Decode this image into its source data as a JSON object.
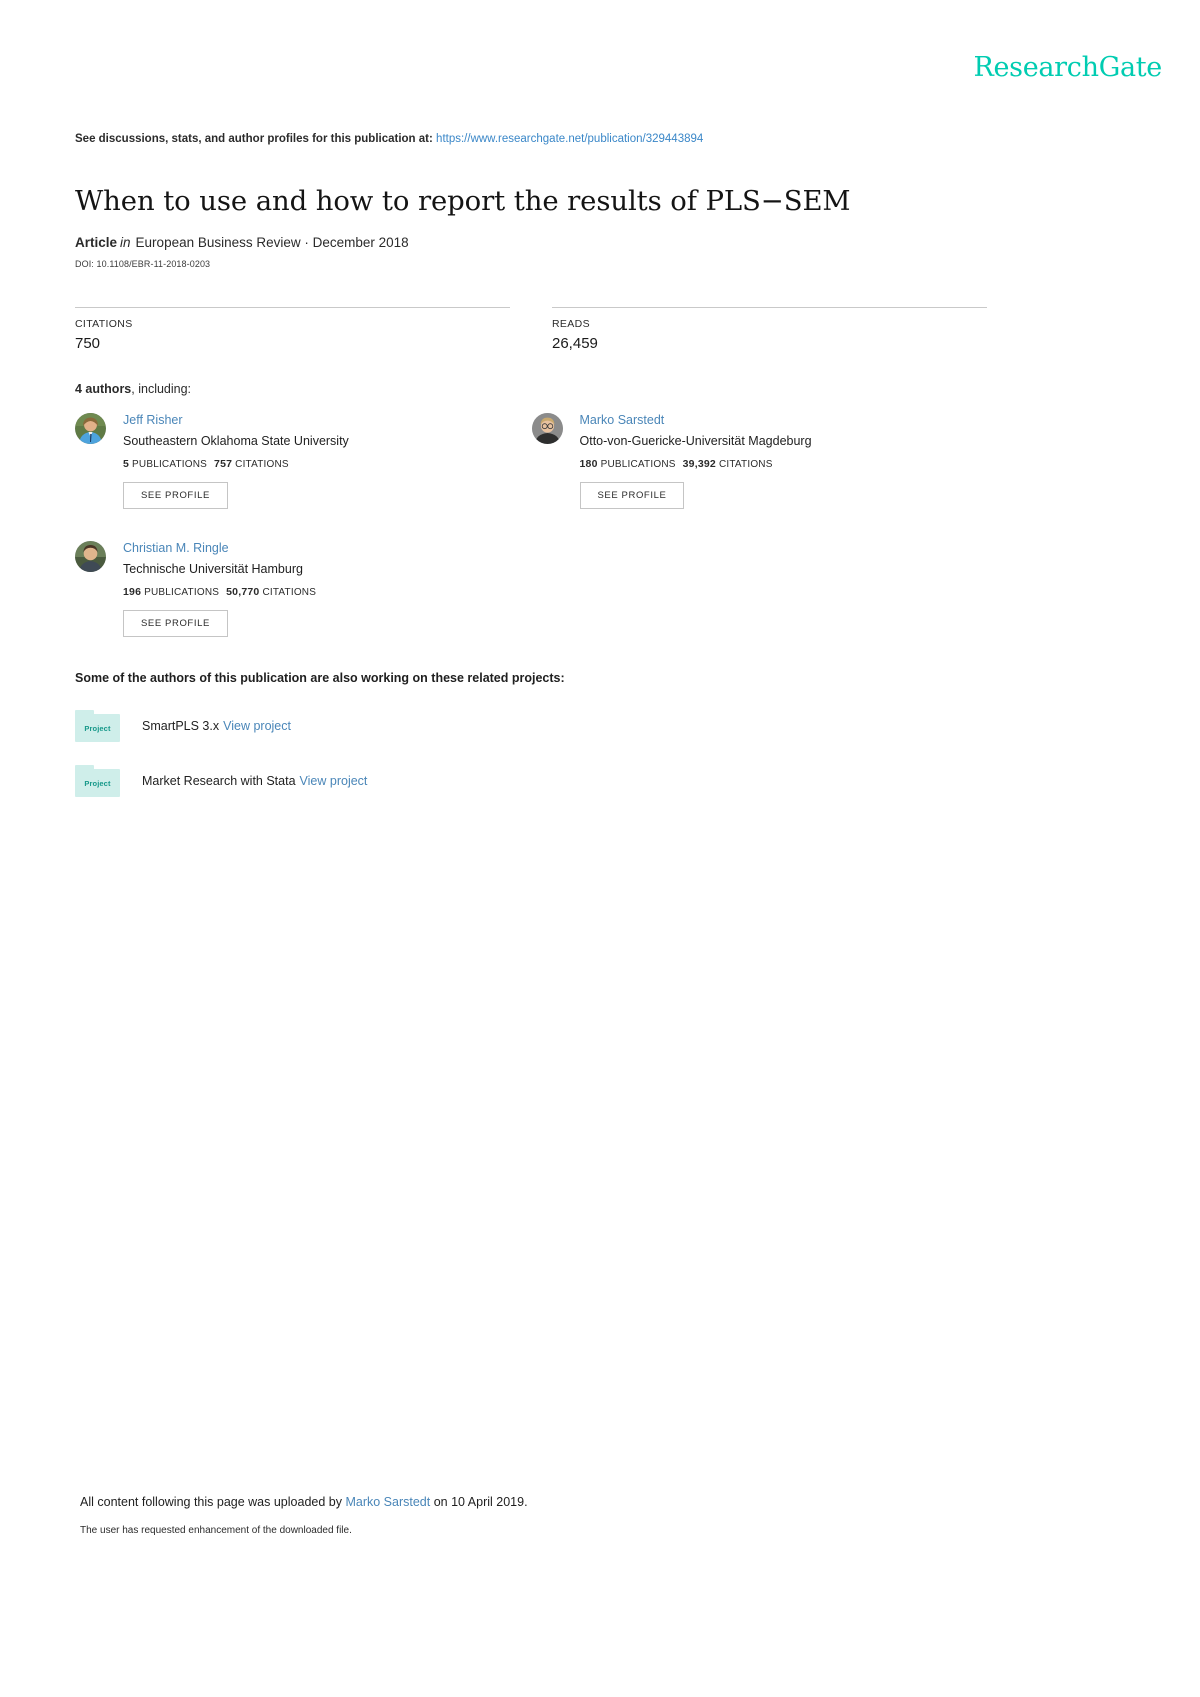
{
  "brand": {
    "logo_text": "ResearchGate",
    "logo_color": "#00ccb1",
    "link_color": "#4a86b8"
  },
  "header": {
    "discussion_prefix": "See discussions, stats, and author profiles for this publication at:",
    "publication_url": "https://www.researchgate.net/publication/329443894"
  },
  "publication": {
    "title": "When to use and how to report the results of PLS−SEM",
    "type_label": "Article",
    "in_label": "in",
    "venue_and_date": "European Business Review · December 2018",
    "doi": "DOI: 10.1108/EBR-11-2018-0203"
  },
  "stats": {
    "citations": {
      "label": "CITATIONS",
      "value": "750"
    },
    "reads": {
      "label": "READS",
      "value": "26,459"
    }
  },
  "authors_section": {
    "count_label": "4 authors",
    "including_label": ", including:",
    "see_profile_label": "SEE PROFILE",
    "publications_label": "PUBLICATIONS",
    "citations_label": "CITATIONS",
    "authors": [
      {
        "name": "Jeff Risher",
        "affiliation": "Southeastern Oklahoma State University",
        "publications": "5",
        "citations": "757"
      },
      {
        "name": "Marko Sarstedt",
        "affiliation": "Otto-von-Guericke-Universität Magdeburg",
        "publications": "180",
        "citations": "39,392"
      },
      {
        "name": "Christian M. Ringle",
        "affiliation": "Technische Universität Hamburg",
        "publications": "196",
        "citations": "50,770"
      }
    ]
  },
  "projects_section": {
    "heading": "Some of the authors of this publication are also working on these related projects:",
    "icon_label": "Project",
    "view_label": "View project",
    "projects": [
      {
        "name": "SmartPLS 3.x"
      },
      {
        "name": "Market Research with Stata"
      }
    ]
  },
  "footer": {
    "upload_prefix": "All content following this page was uploaded by",
    "uploader": "Marko Sarstedt",
    "upload_suffix": "on 10 April 2019.",
    "enhancement_note": "The user has requested enhancement of the downloaded file."
  }
}
